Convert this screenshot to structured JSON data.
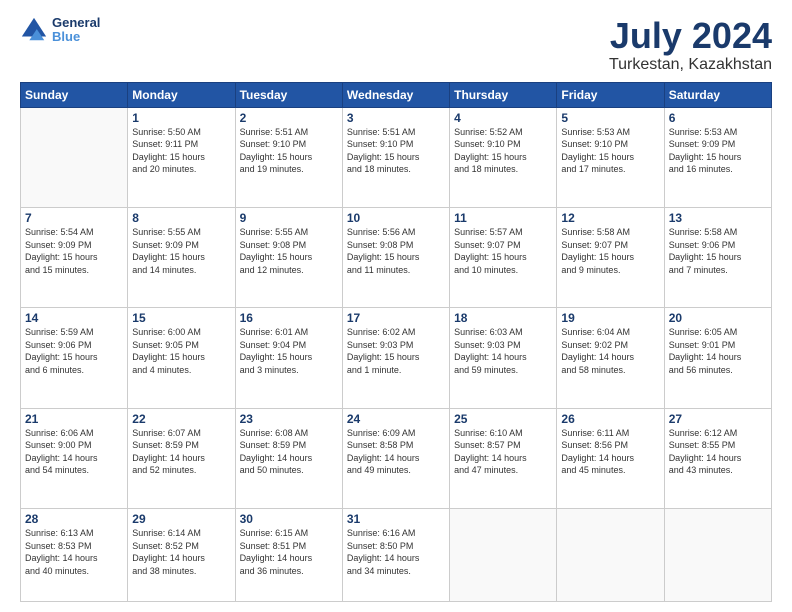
{
  "logo": {
    "line1": "General",
    "line2": "Blue"
  },
  "title": "July 2024",
  "subtitle": "Turkestan, Kazakhstan",
  "weekdays": [
    "Sunday",
    "Monday",
    "Tuesday",
    "Wednesday",
    "Thursday",
    "Friday",
    "Saturday"
  ],
  "weeks": [
    [
      {
        "day": "",
        "info": ""
      },
      {
        "day": "1",
        "info": "Sunrise: 5:50 AM\nSunset: 9:11 PM\nDaylight: 15 hours\nand 20 minutes."
      },
      {
        "day": "2",
        "info": "Sunrise: 5:51 AM\nSunset: 9:10 PM\nDaylight: 15 hours\nand 19 minutes."
      },
      {
        "day": "3",
        "info": "Sunrise: 5:51 AM\nSunset: 9:10 PM\nDaylight: 15 hours\nand 18 minutes."
      },
      {
        "day": "4",
        "info": "Sunrise: 5:52 AM\nSunset: 9:10 PM\nDaylight: 15 hours\nand 18 minutes."
      },
      {
        "day": "5",
        "info": "Sunrise: 5:53 AM\nSunset: 9:10 PM\nDaylight: 15 hours\nand 17 minutes."
      },
      {
        "day": "6",
        "info": "Sunrise: 5:53 AM\nSunset: 9:09 PM\nDaylight: 15 hours\nand 16 minutes."
      }
    ],
    [
      {
        "day": "7",
        "info": "Sunrise: 5:54 AM\nSunset: 9:09 PM\nDaylight: 15 hours\nand 15 minutes."
      },
      {
        "day": "8",
        "info": "Sunrise: 5:55 AM\nSunset: 9:09 PM\nDaylight: 15 hours\nand 14 minutes."
      },
      {
        "day": "9",
        "info": "Sunrise: 5:55 AM\nSunset: 9:08 PM\nDaylight: 15 hours\nand 12 minutes."
      },
      {
        "day": "10",
        "info": "Sunrise: 5:56 AM\nSunset: 9:08 PM\nDaylight: 15 hours\nand 11 minutes."
      },
      {
        "day": "11",
        "info": "Sunrise: 5:57 AM\nSunset: 9:07 PM\nDaylight: 15 hours\nand 10 minutes."
      },
      {
        "day": "12",
        "info": "Sunrise: 5:58 AM\nSunset: 9:07 PM\nDaylight: 15 hours\nand 9 minutes."
      },
      {
        "day": "13",
        "info": "Sunrise: 5:58 AM\nSunset: 9:06 PM\nDaylight: 15 hours\nand 7 minutes."
      }
    ],
    [
      {
        "day": "14",
        "info": "Sunrise: 5:59 AM\nSunset: 9:06 PM\nDaylight: 15 hours\nand 6 minutes."
      },
      {
        "day": "15",
        "info": "Sunrise: 6:00 AM\nSunset: 9:05 PM\nDaylight: 15 hours\nand 4 minutes."
      },
      {
        "day": "16",
        "info": "Sunrise: 6:01 AM\nSunset: 9:04 PM\nDaylight: 15 hours\nand 3 minutes."
      },
      {
        "day": "17",
        "info": "Sunrise: 6:02 AM\nSunset: 9:03 PM\nDaylight: 15 hours\nand 1 minute."
      },
      {
        "day": "18",
        "info": "Sunrise: 6:03 AM\nSunset: 9:03 PM\nDaylight: 14 hours\nand 59 minutes."
      },
      {
        "day": "19",
        "info": "Sunrise: 6:04 AM\nSunset: 9:02 PM\nDaylight: 14 hours\nand 58 minutes."
      },
      {
        "day": "20",
        "info": "Sunrise: 6:05 AM\nSunset: 9:01 PM\nDaylight: 14 hours\nand 56 minutes."
      }
    ],
    [
      {
        "day": "21",
        "info": "Sunrise: 6:06 AM\nSunset: 9:00 PM\nDaylight: 14 hours\nand 54 minutes."
      },
      {
        "day": "22",
        "info": "Sunrise: 6:07 AM\nSunset: 8:59 PM\nDaylight: 14 hours\nand 52 minutes."
      },
      {
        "day": "23",
        "info": "Sunrise: 6:08 AM\nSunset: 8:59 PM\nDaylight: 14 hours\nand 50 minutes."
      },
      {
        "day": "24",
        "info": "Sunrise: 6:09 AM\nSunset: 8:58 PM\nDaylight: 14 hours\nand 49 minutes."
      },
      {
        "day": "25",
        "info": "Sunrise: 6:10 AM\nSunset: 8:57 PM\nDaylight: 14 hours\nand 47 minutes."
      },
      {
        "day": "26",
        "info": "Sunrise: 6:11 AM\nSunset: 8:56 PM\nDaylight: 14 hours\nand 45 minutes."
      },
      {
        "day": "27",
        "info": "Sunrise: 6:12 AM\nSunset: 8:55 PM\nDaylight: 14 hours\nand 43 minutes."
      }
    ],
    [
      {
        "day": "28",
        "info": "Sunrise: 6:13 AM\nSunset: 8:53 PM\nDaylight: 14 hours\nand 40 minutes."
      },
      {
        "day": "29",
        "info": "Sunrise: 6:14 AM\nSunset: 8:52 PM\nDaylight: 14 hours\nand 38 minutes."
      },
      {
        "day": "30",
        "info": "Sunrise: 6:15 AM\nSunset: 8:51 PM\nDaylight: 14 hours\nand 36 minutes."
      },
      {
        "day": "31",
        "info": "Sunrise: 6:16 AM\nSunset: 8:50 PM\nDaylight: 14 hours\nand 34 minutes."
      },
      {
        "day": "",
        "info": ""
      },
      {
        "day": "",
        "info": ""
      },
      {
        "day": "",
        "info": ""
      }
    ]
  ]
}
